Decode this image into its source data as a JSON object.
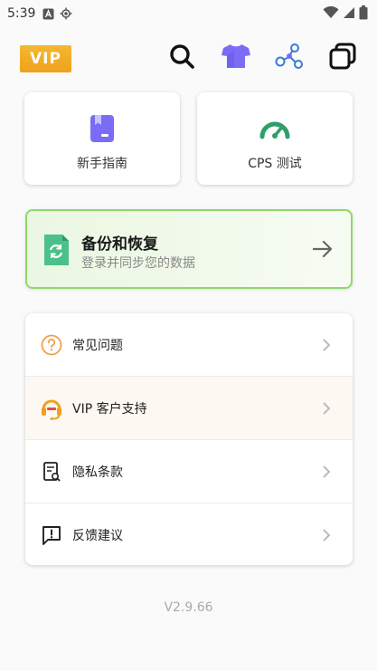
{
  "status_bar": {
    "time": "5:39"
  },
  "toolbar": {
    "vip_label": "VIP"
  },
  "quick_actions": [
    {
      "label": "新手指南",
      "icon": "guide-book-icon"
    },
    {
      "label": "CPS 测试",
      "icon": "speedometer-icon"
    }
  ],
  "backup": {
    "title": "备份和恢复",
    "subtitle": "登录并同步您的数据"
  },
  "menu": [
    {
      "label": "常见问题",
      "icon": "question-circle-icon"
    },
    {
      "label": "VIP 客户支持",
      "icon": "headset-icon"
    },
    {
      "label": "隐私条款",
      "icon": "privacy-document-icon"
    },
    {
      "label": "反馈建议",
      "icon": "feedback-icon"
    }
  ],
  "version": "V2.9.66",
  "colors": {
    "vip_gold": "#f2ad25",
    "accent_purple": "#7b6cf6",
    "accent_green": "#2f9e6a",
    "backup_border": "#8fd86b",
    "question_orange": "#f0a04b"
  }
}
